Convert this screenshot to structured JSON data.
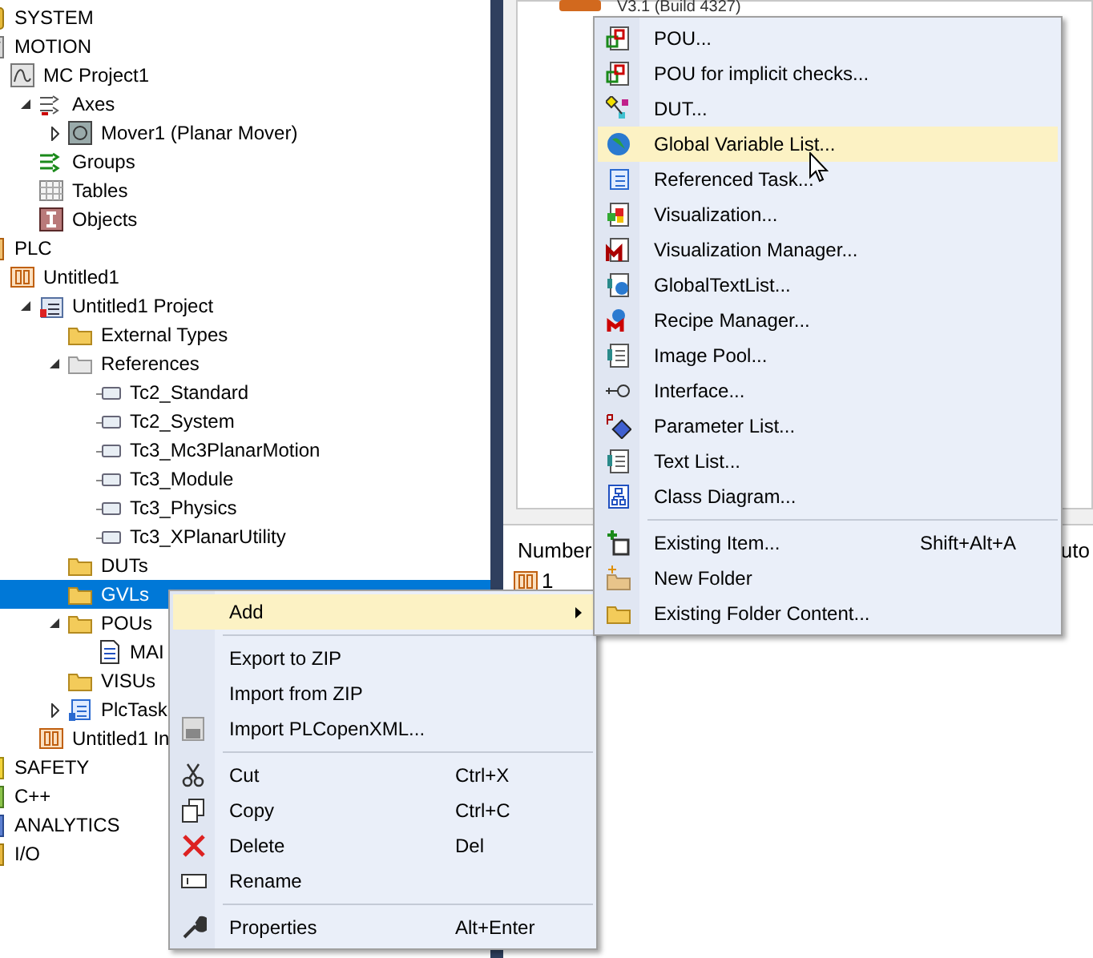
{
  "tree": [
    {
      "label": "SYSTEM",
      "kind": "category-system",
      "selected": false
    },
    {
      "label": "MOTION",
      "kind": "category-motion",
      "selected": false,
      "children": [
        {
          "label": "MC Project1",
          "kind": "mc-project",
          "selected": false,
          "children": [
            {
              "label": "Axes",
              "kind": "axes",
              "selected": false,
              "expanded": true,
              "children": [
                {
                  "label": "Mover1 (Planar Mover)",
                  "kind": "mover",
                  "selected": false,
                  "expanded": false
                }
              ]
            },
            {
              "label": "Groups",
              "kind": "groups",
              "selected": false
            },
            {
              "label": "Tables",
              "kind": "tables",
              "selected": false
            },
            {
              "label": "Objects",
              "kind": "objects",
              "selected": false
            }
          ]
        }
      ]
    },
    {
      "label": "PLC",
      "kind": "category-plc",
      "selected": false,
      "children": [
        {
          "label": "Untitled1",
          "kind": "plc-instance",
          "selected": false,
          "children": [
            {
              "label": "Untitled1 Project",
              "kind": "plc-project",
              "selected": false,
              "expanded": true,
              "children": [
                {
                  "label": "External Types",
                  "kind": "folder",
                  "selected": false
                },
                {
                  "label": "References",
                  "kind": "references",
                  "selected": false,
                  "expanded": true,
                  "children": [
                    {
                      "label": "Tc2_Standard",
                      "kind": "library",
                      "selected": false
                    },
                    {
                      "label": "Tc2_System",
                      "kind": "library",
                      "selected": false
                    },
                    {
                      "label": "Tc3_Mc3PlanarMotion",
                      "kind": "library",
                      "selected": false
                    },
                    {
                      "label": "Tc3_Module",
                      "kind": "library",
                      "selected": false
                    },
                    {
                      "label": "Tc3_Physics",
                      "kind": "library",
                      "selected": false
                    },
                    {
                      "label": "Tc3_XPlanarUtility",
                      "kind": "library",
                      "selected": false
                    }
                  ]
                },
                {
                  "label": "DUTs",
                  "kind": "folder",
                  "selected": false
                },
                {
                  "label": "GVLs",
                  "kind": "folder",
                  "selected": true
                },
                {
                  "label": "POUs",
                  "kind": "folder",
                  "selected": false,
                  "expanded": true,
                  "children": [
                    {
                      "label": "MAI",
                      "kind": "program",
                      "selected": false
                    }
                  ]
                },
                {
                  "label": "VISUs",
                  "kind": "folder",
                  "selected": false
                },
                {
                  "label": "PlcTask",
                  "kind": "task",
                  "selected": false,
                  "expanded": false
                }
              ]
            },
            {
              "label": "Untitled1 In",
              "kind": "plc-instance",
              "selected": false
            }
          ]
        }
      ]
    },
    {
      "label": "SAFETY",
      "kind": "category-safety",
      "selected": false
    },
    {
      "label": "C++",
      "kind": "category-cpp",
      "selected": false
    },
    {
      "label": "ANALYTICS",
      "kind": "category-analytics",
      "selected": false
    },
    {
      "label": "I/O",
      "kind": "category-io",
      "selected": false
    }
  ],
  "top_panel": {
    "version": "V3.1 (Build 4327)"
  },
  "bottom_panel": {
    "columns": [
      "Number",
      "uto"
    ],
    "rows": [
      {
        "number": "1"
      }
    ]
  },
  "context_menu": [
    {
      "kind": "item",
      "label": "Add",
      "selected": true,
      "submenu": true
    },
    {
      "kind": "separator"
    },
    {
      "kind": "item",
      "label": "Export to ZIP",
      "selected": false
    },
    {
      "kind": "item",
      "label": "Import from ZIP",
      "selected": false
    },
    {
      "kind": "item",
      "label": "Import PLCopenXML...",
      "selected": false
    },
    {
      "kind": "separator"
    },
    {
      "kind": "item",
      "label": "Cut",
      "selected": false,
      "shortcut": "Ctrl+X"
    },
    {
      "kind": "item",
      "label": "Copy",
      "selected": false,
      "shortcut": "Ctrl+C"
    },
    {
      "kind": "item",
      "label": "Delete",
      "selected": false,
      "shortcut": "Del"
    },
    {
      "kind": "item",
      "label": "Rename",
      "selected": false
    },
    {
      "kind": "separator"
    },
    {
      "kind": "item",
      "label": "Properties",
      "selected": false,
      "shortcut": "Alt+Enter"
    }
  ],
  "submenu": [
    {
      "kind": "item",
      "label": "POU...",
      "selected": false
    },
    {
      "kind": "item",
      "label": "POU for implicit checks...",
      "selected": false
    },
    {
      "kind": "item",
      "label": "DUT...",
      "selected": false
    },
    {
      "kind": "item",
      "label": "Global Variable List...",
      "selected": true
    },
    {
      "kind": "item",
      "label": "Referenced Task...",
      "selected": false
    },
    {
      "kind": "item",
      "label": "Visualization...",
      "selected": false
    },
    {
      "kind": "item",
      "label": "Visualization Manager...",
      "selected": false
    },
    {
      "kind": "item",
      "label": "GlobalTextList...",
      "selected": false
    },
    {
      "kind": "item",
      "label": "Recipe Manager...",
      "selected": false
    },
    {
      "kind": "item",
      "label": "Image Pool...",
      "selected": false
    },
    {
      "kind": "item",
      "label": "Interface...",
      "selected": false
    },
    {
      "kind": "item",
      "label": "Parameter List...",
      "selected": false
    },
    {
      "kind": "item",
      "label": "Text List...",
      "selected": false
    },
    {
      "kind": "item",
      "label": "Class Diagram...",
      "selected": false
    },
    {
      "kind": "separator"
    },
    {
      "kind": "item",
      "label": "Existing Item...",
      "selected": false,
      "shortcut": "Shift+Alt+A"
    },
    {
      "kind": "item",
      "label": "New Folder",
      "selected": false
    },
    {
      "kind": "item",
      "label": "Existing Folder Content...",
      "selected": false
    }
  ]
}
